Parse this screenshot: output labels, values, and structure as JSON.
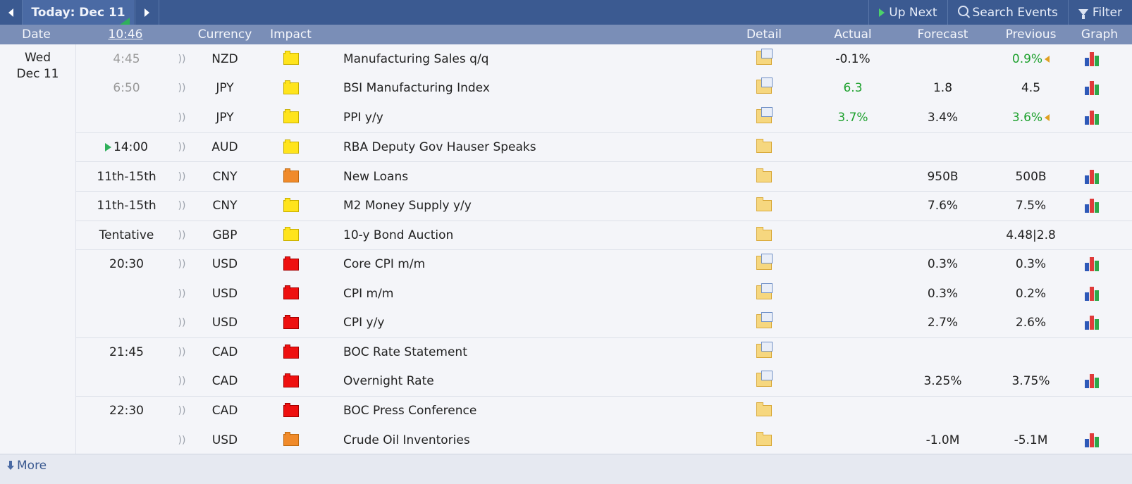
{
  "topbar": {
    "today_label": "Today: Dec 11",
    "up_next": "Up Next",
    "search_events": "Search Events",
    "filter": "Filter"
  },
  "header": {
    "date": "Date",
    "time": "10:46",
    "currency": "Currency",
    "impact": "Impact",
    "detail": "Detail",
    "actual": "Actual",
    "forecast": "Forecast",
    "previous": "Previous",
    "graph": "Graph"
  },
  "date": {
    "weekday": "Wed",
    "day": "Dec 11"
  },
  "colors": {
    "green": "#1ea12e",
    "yellow": "#ffe41c",
    "orange": "#f08a2a",
    "red": "#ee1010"
  },
  "rows": [
    {
      "time": "4:45",
      "currency": "NZD",
      "impact": "yellow",
      "event": "Manufacturing Sales q/q",
      "actual": "-0.1%",
      "forecast": "",
      "previous": "0.9%",
      "graph": true
    },
    {
      "time": "6:50",
      "currency": "JPY",
      "impact": "yellow",
      "event": "BSI Manufacturing Index",
      "actual": "6.3",
      "forecast": "1.8",
      "previous": "4.5",
      "graph": true
    },
    {
      "time": "",
      "currency": "JPY",
      "impact": "yellow",
      "event": "PPI y/y",
      "actual": "3.7%",
      "forecast": "3.4%",
      "previous": "3.6%",
      "graph": true
    },
    {
      "time": "14:00",
      "currency": "AUD",
      "impact": "yellow",
      "event": "RBA Deputy Gov Hauser Speaks",
      "actual": "",
      "forecast": "",
      "previous": "",
      "graph": false
    },
    {
      "time": "11th-15th",
      "currency": "CNY",
      "impact": "orange",
      "event": "New Loans",
      "actual": "",
      "forecast": "950B",
      "previous": "500B",
      "graph": true
    },
    {
      "time": "11th-15th",
      "currency": "CNY",
      "impact": "yellow",
      "event": "M2 Money Supply y/y",
      "actual": "",
      "forecast": "7.6%",
      "previous": "7.5%",
      "graph": true
    },
    {
      "time": "Tentative",
      "currency": "GBP",
      "impact": "yellow",
      "event": "10-y Bond Auction",
      "actual": "",
      "forecast": "",
      "previous": "4.48|2.8",
      "graph": false
    },
    {
      "time": "20:30",
      "currency": "USD",
      "impact": "red",
      "event": "Core CPI m/m",
      "actual": "",
      "forecast": "0.3%",
      "previous": "0.3%",
      "graph": true
    },
    {
      "time": "",
      "currency": "USD",
      "impact": "red",
      "event": "CPI m/m",
      "actual": "",
      "forecast": "0.3%",
      "previous": "0.2%",
      "graph": true
    },
    {
      "time": "",
      "currency": "USD",
      "impact": "red",
      "event": "CPI y/y",
      "actual": "",
      "forecast": "2.7%",
      "previous": "2.6%",
      "graph": true
    },
    {
      "time": "21:45",
      "currency": "CAD",
      "impact": "red",
      "event": "BOC Rate Statement",
      "actual": "",
      "forecast": "",
      "previous": "",
      "graph": false
    },
    {
      "time": "",
      "currency": "CAD",
      "impact": "red",
      "event": "Overnight Rate",
      "actual": "",
      "forecast": "3.25%",
      "previous": "3.75%",
      "graph": true
    },
    {
      "time": "22:30",
      "currency": "CAD",
      "impact": "red",
      "event": "BOC Press Conference",
      "actual": "",
      "forecast": "",
      "previous": "",
      "graph": false
    },
    {
      "time": "",
      "currency": "USD",
      "impact": "orange",
      "event": "Crude Oil Inventories",
      "actual": "",
      "forecast": "-1.0M",
      "previous": "-5.1M",
      "graph": true
    }
  ],
  "footer": {
    "more": "More"
  }
}
